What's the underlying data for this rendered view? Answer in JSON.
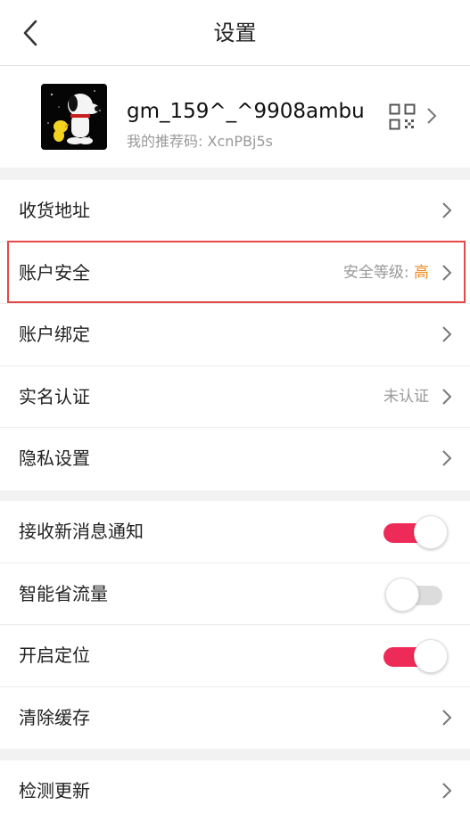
{
  "header": {
    "title": "设置"
  },
  "profile": {
    "username": "gm_159^_^9908ambu",
    "referral": "我的推荐码: XcnPBj5s"
  },
  "section1": [
    {
      "label": "收货地址",
      "value": "",
      "accent": ""
    },
    {
      "label": "账户安全",
      "value": "安全等级: ",
      "accent": "高"
    },
    {
      "label": "账户绑定",
      "value": "",
      "accent": ""
    },
    {
      "label": "实名认证",
      "value": "未认证",
      "accent": ""
    },
    {
      "label": "隐私设置",
      "value": "",
      "accent": ""
    }
  ],
  "section2": [
    {
      "label": "接收新消息通知",
      "toggle": "on"
    },
    {
      "label": "智能省流量",
      "toggle": "off"
    },
    {
      "label": "开启定位",
      "toggle": "on"
    },
    {
      "label": "清除缓存"
    }
  ],
  "section3": [
    {
      "label": "检测更新"
    }
  ],
  "colors": {
    "accent": "#f08a22",
    "toggle_on": "#ee2b58",
    "highlight": "#e54848"
  }
}
